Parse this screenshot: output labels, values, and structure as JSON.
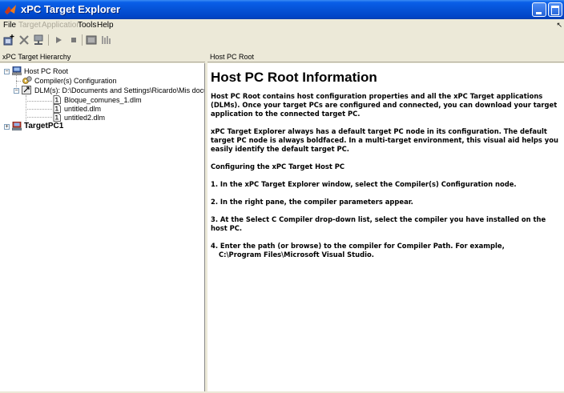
{
  "window": {
    "title": "xPC Target Explorer",
    "app_icon": "matlab-logo-icon",
    "controls": [
      "minimize-icon",
      "maximize-icon",
      "close-icon"
    ]
  },
  "menubar": {
    "items": [
      {
        "label": "File",
        "enabled": true
      },
      {
        "label": "Target",
        "enabled": false
      },
      {
        "label": "Application",
        "enabled": false
      },
      {
        "label": "Tools",
        "enabled": true
      },
      {
        "label": "Help",
        "enabled": true
      }
    ],
    "overflow_mark": "↖"
  },
  "toolbar": {
    "buttons": [
      "add-target-icon",
      "delete-icon",
      "connect-icon",
      "start-icon",
      "stop-icon",
      "scope-icon",
      "scope-viewer-icon"
    ]
  },
  "left_pane": {
    "header": "xPC Target Hierarchy",
    "tree": [
      {
        "label": "Host PC Root",
        "icon": "host-pc-icon",
        "expander": "−",
        "bold": false
      },
      {
        "label": "Compiler(s) Configuration",
        "icon": "compiler-config-icon",
        "expander": "",
        "bold": false
      },
      {
        "label": "DLM(s): D:\\Documents and Settings\\Ricardo\\Mis documentos",
        "icon": "dlm-folder-icon",
        "expander": "−",
        "bold": false
      },
      {
        "label": "Bloque_comunes_1.dlm",
        "icon": "dlm-file-icon",
        "expander": "",
        "bold": false
      },
      {
        "label": "untitled.dlm",
        "icon": "dlm-file-icon",
        "expander": "",
        "bold": false
      },
      {
        "label": "untitled2.dlm",
        "icon": "dlm-file-icon",
        "expander": "",
        "bold": false
      },
      {
        "label": "TargetPC1",
        "icon": "target-pc-icon",
        "expander": "+",
        "bold": true
      }
    ]
  },
  "right_pane": {
    "header": "Host PC Root",
    "heading": "Host PC Root Information",
    "paragraphs": [
      "Host PC Root contains host configuration properties and all the xPC Target applications (DLMs). Once your target PCs are configured and connected, you can download your target application to the connected target PC.",
      "xPC Target Explorer always has a default target PC node in its configuration. The default target PC node is always boldfaced. In a multi-target environment, this visual aid helps you easily identify the default target PC.",
      "Configuring the xPC Target Host PC",
      "1. In the xPC Target Explorer window, select the Compiler(s) Configuration node.",
      "2. In the right pane, the compiler parameters appear.",
      "3. At the Select C Compiler drop-down list, select the compiler you have installed on the host PC.",
      "4. Enter the path (or browse) to the compiler for Compiler Path. For example,"
    ],
    "example_path": "C:\\Program Files\\Microsoft Visual Studio."
  }
}
